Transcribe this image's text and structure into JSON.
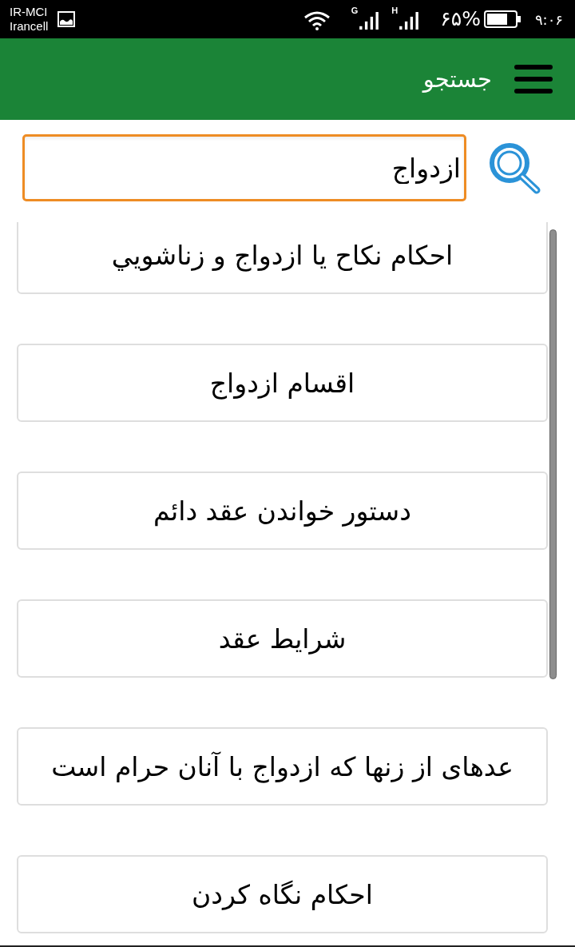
{
  "status_bar": {
    "carrier_lines": [
      "IR-MCI",
      "Irancell"
    ],
    "network_labels": [
      "H",
      "G"
    ],
    "battery_percent": "۶۵%",
    "time": "۹:۰۶"
  },
  "header": {
    "title": "جستجو"
  },
  "search": {
    "value": "ازدواج"
  },
  "results": [
    {
      "title": "احکام نکاح یا ازدواج و زناشويي"
    },
    {
      "title": "اقسام ازدواج"
    },
    {
      "title": "دستور خواندن عقد دائم"
    },
    {
      "title": "شرایط عقد"
    },
    {
      "title": "عدهای از زنها که ازدواج با آنان حرام است"
    },
    {
      "title": "احکام نگاه کردن"
    }
  ]
}
